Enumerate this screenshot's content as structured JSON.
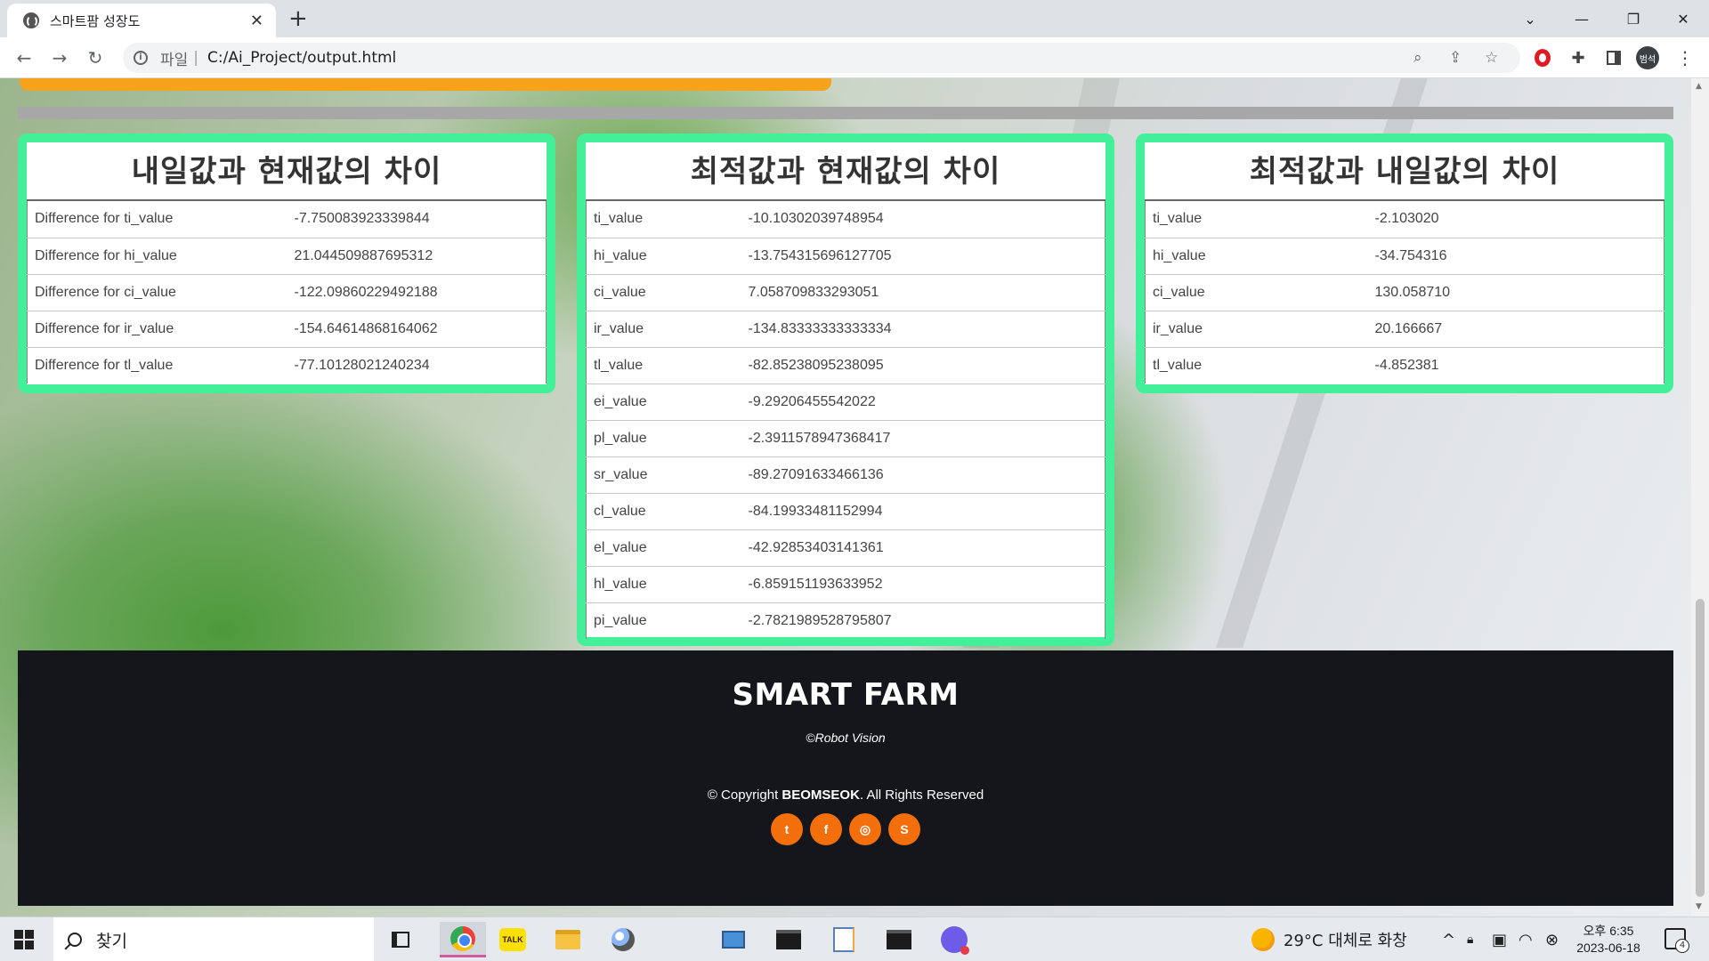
{
  "browser": {
    "tab_title": "스마트팜 성장도",
    "tab_close": "✕",
    "new_tab": "+",
    "url_prefix": "파일",
    "url_separator": "|",
    "url": "C:/Ai_Project/output.html",
    "profile_label": "범석",
    "window_controls": {
      "menu": "⌄",
      "minimize": "—",
      "restore": "❐",
      "close": "✕"
    }
  },
  "cards": [
    {
      "title": "내일값과 현재값의 차이",
      "rows": [
        {
          "key": "Difference for ti_value",
          "value": "-7.750083923339844"
        },
        {
          "key": "Difference for hi_value",
          "value": "21.044509887695312"
        },
        {
          "key": "Difference for ci_value",
          "value": "-122.09860229492188"
        },
        {
          "key": "Difference for ir_value",
          "value": "-154.64614868164062"
        },
        {
          "key": "Difference for tl_value",
          "value": "-77.10128021240234"
        }
      ]
    },
    {
      "title": "최적값과 현재값의 차이",
      "rows": [
        {
          "key": "ti_value",
          "value": "-10.10302039748954"
        },
        {
          "key": "hi_value",
          "value": "-13.754315696127705"
        },
        {
          "key": "ci_value",
          "value": "7.058709833293051"
        },
        {
          "key": "ir_value",
          "value": "-134.83333333333334"
        },
        {
          "key": "tl_value",
          "value": "-82.85238095238095"
        },
        {
          "key": "ei_value",
          "value": "-9.29206455542022"
        },
        {
          "key": "pl_value",
          "value": "-2.3911578947368417"
        },
        {
          "key": "sr_value",
          "value": "-89.27091633466136"
        },
        {
          "key": "cl_value",
          "value": "-84.19933481152994"
        },
        {
          "key": "el_value",
          "value": "-42.92853403141361"
        },
        {
          "key": "hl_value",
          "value": "-6.859151193633952"
        },
        {
          "key": "pi_value",
          "value": "-2.7821989528795807"
        }
      ]
    },
    {
      "title": "최적값과 내일값의 차이",
      "rows": [
        {
          "key": "ti_value",
          "value": "-2.103020"
        },
        {
          "key": "hi_value",
          "value": "-34.754316"
        },
        {
          "key": "ci_value",
          "value": "130.058710"
        },
        {
          "key": "ir_value",
          "value": "20.166667"
        },
        {
          "key": "tl_value",
          "value": "-4.852381"
        }
      ]
    }
  ],
  "footer": {
    "title": "SMART FARM",
    "subtitle": "©Robot Vision",
    "copyright_prefix": "© Copyright",
    "copyright_owner": "BEOMSEOK",
    "copyright_suffix": ". All Rights Reserved",
    "social": [
      {
        "name": "twitter-icon",
        "glyph": "t"
      },
      {
        "name": "facebook-icon",
        "glyph": "f"
      },
      {
        "name": "instagram-icon",
        "glyph": "◎"
      },
      {
        "name": "skype-icon",
        "glyph": "S"
      }
    ],
    "accent_color": "#f36f0c"
  },
  "colors": {
    "card_border": "#44ef9a",
    "top_bar": "#f7a21b",
    "footer_bg": "#14161c"
  },
  "taskbar": {
    "search_label": "찾기",
    "weather": "29°C  대체로 화창",
    "clock_time": "오후 6:35",
    "clock_date": "2023-06-18",
    "notification_count": "4"
  }
}
